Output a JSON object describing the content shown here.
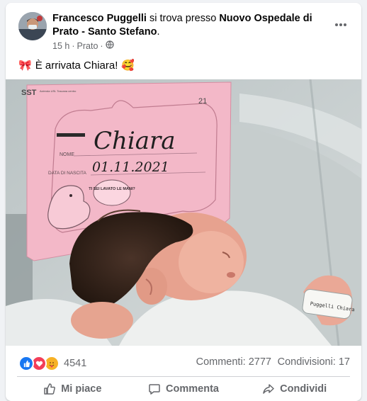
{
  "post": {
    "author_name": "Francesco Puggelli",
    "location_prefix": "si trova presso",
    "location_name": "Nuovo Ospedale di Prato - Santo Stefano",
    "location_suffix": ".",
    "time": "15 h",
    "separator": "·",
    "place": "Prato",
    "privacy_icon": "globe-icon",
    "text_emoji_start": "🎀",
    "text": "È arrivata Chiara!",
    "text_emoji_end": "🥰"
  },
  "photo_card": {
    "brand": "SST",
    "brand_sub": "Azienda USL Toscana centro",
    "number": "21",
    "name_label": "NOME",
    "name_value": "Chiara",
    "date_label": "DATA DI NASCITA",
    "date_value": "01.11.2021",
    "bubble_text": "TI SEI LAVATO LE MANI?",
    "bracelet_text": "Puggelli Chiara"
  },
  "stats": {
    "reaction_icons": [
      "like-icon",
      "love-icon",
      "care-icon"
    ],
    "reaction_colors": [
      "#1877f2",
      "#f33e58",
      "#f7b125"
    ],
    "reaction_count": "4541",
    "comments": "Commenti: 2777",
    "shares": "Condivisioni: 17"
  },
  "actions": {
    "like": "Mi piace",
    "comment": "Commenta",
    "share": "Condividi"
  }
}
